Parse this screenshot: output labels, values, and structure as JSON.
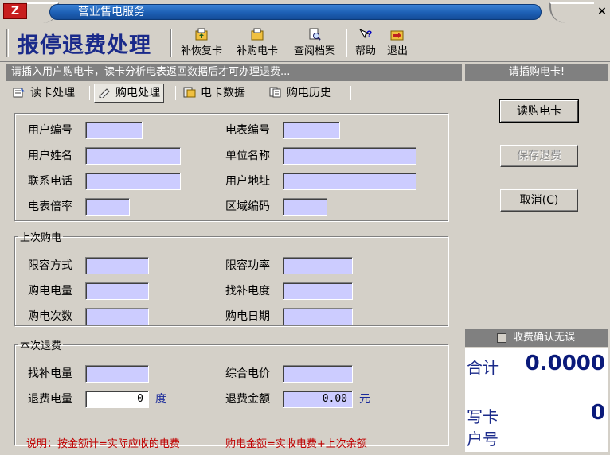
{
  "window": {
    "title": "营业售电服务",
    "close_glyph": "×",
    "logo": "Z"
  },
  "toolbar": {
    "heading": "报停退费处理",
    "buttons": [
      {
        "label": "补恢复卡",
        "icon": "card-restore-icon"
      },
      {
        "label": "补购电卡",
        "icon": "card-buy-icon"
      },
      {
        "label": "查阅档案",
        "icon": "archive-search-icon"
      },
      {
        "label": "帮助",
        "icon": "help-icon"
      },
      {
        "label": "退出",
        "icon": "exit-icon"
      }
    ]
  },
  "hint": "请插入用户购电卡，读卡分析电表返回数据后才可办理退费...",
  "tabs": [
    {
      "label": "读卡处理",
      "icon": "read-card-icon",
      "active": false
    },
    {
      "label": "购电处理",
      "icon": "buy-power-icon",
      "active": true
    },
    {
      "label": "电卡数据",
      "icon": "card-data-icon",
      "active": false
    },
    {
      "label": "购电历史",
      "icon": "history-icon",
      "active": false
    }
  ],
  "user_info": {
    "user_no": "用户编号",
    "meter_no": "电表编号",
    "user_name": "用户姓名",
    "unit_name": "单位名称",
    "phone": "联系电话",
    "address": "用户地址",
    "multiplier": "电表倍率",
    "area_code": "区域编码"
  },
  "last_purchase": {
    "legend": "上次购电",
    "limit_mode": "限容方式",
    "limit_power": "限容功率",
    "purchase_qty": "购电电量",
    "compensation": "找补电度",
    "purchase_count": "购电次数",
    "purchase_date": "购电日期"
  },
  "refund": {
    "legend": "本次退费",
    "comp_qty_label": "找补电量",
    "price_label": "综合电价",
    "refund_qty_label": "退费电量",
    "refund_qty_value": "0",
    "refund_qty_unit": "度",
    "refund_amt_label": "退费金额",
    "refund_amt_value": "0.00",
    "refund_amt_unit": "元",
    "note1": "说明：按金额计=实际应收的电费",
    "note2": "购电金额=实收电费+上次余额"
  },
  "right": {
    "header": "请插购电卡!",
    "read_btn": "读购电卡",
    "save_btn": "保存退费",
    "cancel_btn": "取消(C)",
    "confirm_label": "收费确认无误",
    "total_label": "合计",
    "total_value": "0.0000",
    "write_card_label": "写卡",
    "account_label": "户号",
    "write_card_value": "0"
  },
  "colors": {
    "title_bar": "#1d5fb4",
    "heading": "#1a2a8a",
    "field_bg": "#ccccff",
    "note": "#c00000"
  }
}
